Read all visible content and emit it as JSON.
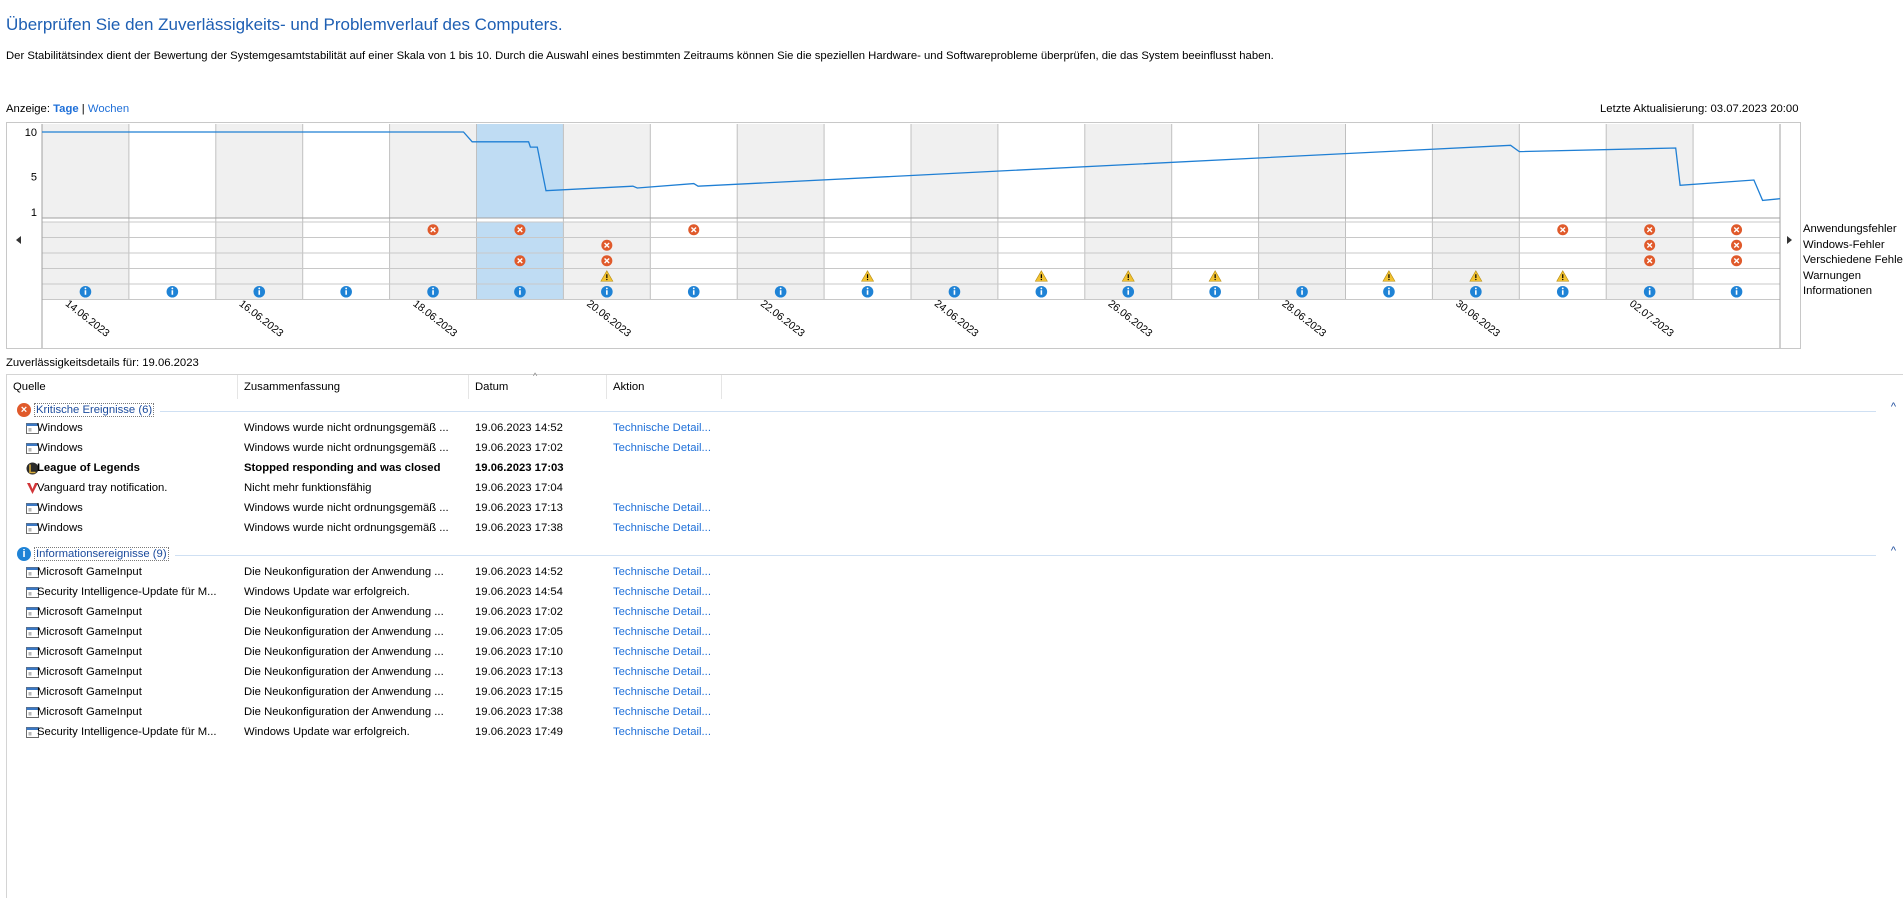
{
  "header": {
    "title": "Überprüfen Sie den Zuverlässigkeits- und Problemverlauf des Computers.",
    "description": "Der Stabilitätsindex dient der Bewertung der Systemgesamtstabilität auf einer Skala von 1 bis 10. Durch die Auswahl eines bestimmten Zeitraums können Sie die speziellen Hardware- und Softwareprobleme überprüfen, die das System beeinflusst haben."
  },
  "view": {
    "label": "Anzeige:",
    "days": "Tage",
    "separator": "|",
    "weeks": "Wochen",
    "last_update": "Letzte Aktualisierung: 03.07.2023 20:00"
  },
  "chart_data": {
    "type": "line",
    "y_ticks": [
      "10",
      "5",
      "1"
    ],
    "ylim": [
      1,
      10
    ],
    "columns": 20,
    "selected_column": 5,
    "date_labels": [
      {
        "col": 0,
        "text": "14.06.2023"
      },
      {
        "col": 2,
        "text": "16.06.2023"
      },
      {
        "col": 4,
        "text": "18.06.2023"
      },
      {
        "col": 6,
        "text": "20.06.2023"
      },
      {
        "col": 8,
        "text": "22.06.2023"
      },
      {
        "col": 10,
        "text": "24.06.2023"
      },
      {
        "col": 12,
        "text": "26.06.2023"
      },
      {
        "col": 14,
        "text": "28.06.2023"
      },
      {
        "col": 16,
        "text": "30.06.2023"
      },
      {
        "col": 18,
        "text": "02.07.2023"
      }
    ],
    "stability_index": [
      [
        0,
        10
      ],
      [
        4.85,
        10
      ],
      [
        4.95,
        8.9
      ],
      [
        5.6,
        8.9
      ],
      [
        5.62,
        8.3
      ],
      [
        5.7,
        8.3
      ],
      [
        5.8,
        3.4
      ],
      [
        6.8,
        3.9
      ],
      [
        6.85,
        3.7
      ],
      [
        7.5,
        4.2
      ],
      [
        7.55,
        3.9
      ],
      [
        16.9,
        8.5
      ],
      [
        17.0,
        7.8
      ],
      [
        18.8,
        8.2
      ],
      [
        18.85,
        4.0
      ],
      [
        19.7,
        4.6
      ],
      [
        19.8,
        2.3
      ],
      [
        20,
        2.5
      ]
    ],
    "rows": [
      {
        "label": "Anwendungsfehler",
        "kind": "error",
        "cols": [
          4,
          5,
          7,
          17,
          18,
          19
        ]
      },
      {
        "label": "Windows-Fehler",
        "kind": "error",
        "cols": [
          6,
          18,
          19
        ]
      },
      {
        "label": "Verschiedene Fehler",
        "kind": "error",
        "cols": [
          5,
          6,
          18,
          19
        ]
      },
      {
        "label": "Warnungen",
        "kind": "warning",
        "cols": [
          6,
          9,
          11,
          12,
          13,
          15,
          16,
          17
        ]
      },
      {
        "label": "Informationen",
        "kind": "info",
        "cols": [
          0,
          1,
          2,
          3,
          4,
          5,
          6,
          7,
          8,
          9,
          10,
          11,
          12,
          13,
          14,
          15,
          16,
          17,
          18,
          19
        ]
      }
    ]
  },
  "details": {
    "label": "Zuverlässigkeitsdetails für: 19.06.2023",
    "columns": [
      "Quelle",
      "Zusammenfassung",
      "Datum",
      "Aktion"
    ],
    "groups": [
      {
        "title": "Kritische Ereignisse (6)",
        "kind": "error",
        "rows": [
          {
            "icon": "window",
            "source": "Windows",
            "summary": "Windows wurde nicht ordnungsgemäß ...",
            "date": "19.06.2023 14:52",
            "action": "Technische Detail..."
          },
          {
            "icon": "window",
            "source": "Windows",
            "summary": "Windows wurde nicht ordnungsgemäß ...",
            "date": "19.06.2023 17:02",
            "action": "Technische Detail..."
          },
          {
            "icon": "lol",
            "source": "League of Legends",
            "summary": "Stopped responding and was closed",
            "date": "19.06.2023 17:03",
            "action": "",
            "bold": true
          },
          {
            "icon": "vanguard",
            "source": "Vanguard tray notification.",
            "summary": "Nicht mehr funktionsfähig",
            "date": "19.06.2023 17:04",
            "action": ""
          },
          {
            "icon": "window",
            "source": "Windows",
            "summary": "Windows wurde nicht ordnungsgemäß ...",
            "date": "19.06.2023 17:13",
            "action": "Technische Detail..."
          },
          {
            "icon": "window",
            "source": "Windows",
            "summary": "Windows wurde nicht ordnungsgemäß ...",
            "date": "19.06.2023 17:38",
            "action": "Technische Detail..."
          }
        ]
      },
      {
        "title": "Informationsereignisse (9)",
        "kind": "info",
        "rows": [
          {
            "icon": "window",
            "source": "Microsoft GameInput",
            "summary": "Die Neukonfiguration der Anwendung ...",
            "date": "19.06.2023 14:52",
            "action": "Technische Detail..."
          },
          {
            "icon": "window",
            "source": "Security Intelligence-Update für M...",
            "summary": "Windows Update war erfolgreich.",
            "date": "19.06.2023 14:54",
            "action": "Technische Detail..."
          },
          {
            "icon": "window",
            "source": "Microsoft GameInput",
            "summary": "Die Neukonfiguration der Anwendung ...",
            "date": "19.06.2023 17:02",
            "action": "Technische Detail..."
          },
          {
            "icon": "window",
            "source": "Microsoft GameInput",
            "summary": "Die Neukonfiguration der Anwendung ...",
            "date": "19.06.2023 17:05",
            "action": "Technische Detail..."
          },
          {
            "icon": "window",
            "source": "Microsoft GameInput",
            "summary": "Die Neukonfiguration der Anwendung ...",
            "date": "19.06.2023 17:10",
            "action": "Technische Detail..."
          },
          {
            "icon": "window",
            "source": "Microsoft GameInput",
            "summary": "Die Neukonfiguration der Anwendung ...",
            "date": "19.06.2023 17:13",
            "action": "Technische Detail..."
          },
          {
            "icon": "window",
            "source": "Microsoft GameInput",
            "summary": "Die Neukonfiguration der Anwendung ...",
            "date": "19.06.2023 17:15",
            "action": "Technische Detail..."
          },
          {
            "icon": "window",
            "source": "Microsoft GameInput",
            "summary": "Die Neukonfiguration der Anwendung ...",
            "date": "19.06.2023 17:38",
            "action": "Technische Detail..."
          },
          {
            "icon": "window",
            "source": "Security Intelligence-Update für M...",
            "summary": "Windows Update war erfolgreich.",
            "date": "19.06.2023 17:49",
            "action": "Technische Detail..."
          }
        ]
      }
    ]
  },
  "colors": {
    "title": "#1e5fb3",
    "link": "#1e6fd8",
    "line": "#1f7fd4",
    "selected": "#bfdcf3",
    "error": "#e05a2b",
    "warning": "#f2c230",
    "info": "#1f83d6"
  }
}
